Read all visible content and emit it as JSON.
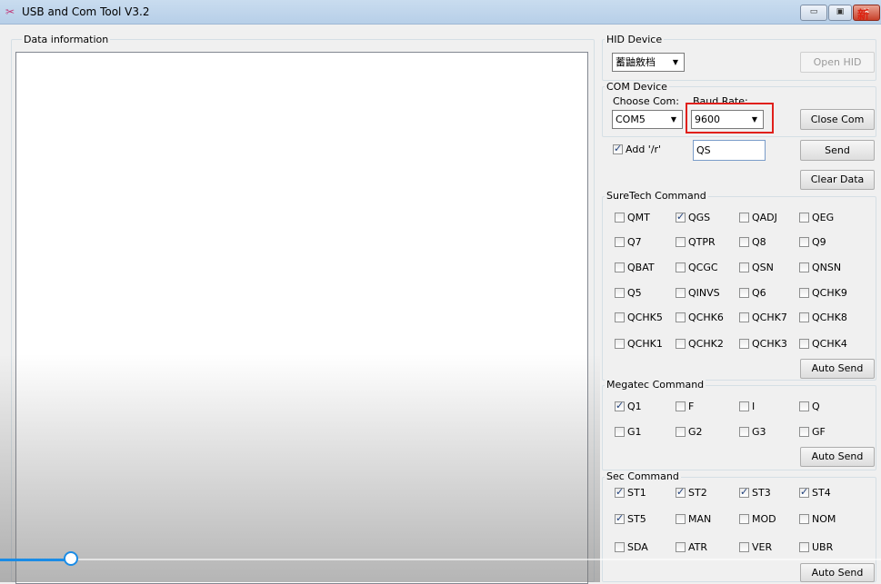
{
  "window": {
    "title": "USB and Com Tool V3.2",
    "app_icon": "tool-icon",
    "minimize": "▭",
    "maximize": "▣",
    "close": "✕",
    "overlay_text": "新"
  },
  "data_info": {
    "title": "Data information"
  },
  "hid": {
    "title": "HID Device",
    "device_value": "蓄鼬敫档",
    "open_label": "Open HID"
  },
  "com": {
    "title": "COM Device",
    "choose_label": "Choose Com:",
    "baud_label": "Baud Rate:",
    "com_value": "COM5",
    "baud_value": "9600",
    "close_label": "Close Com",
    "add_r_label": "Add '/r'",
    "send_text": "QS",
    "send_label": "Send",
    "clear_label": "Clear Data"
  },
  "suretech": {
    "title": "SureTech Command",
    "items": [
      {
        "label": "QMT",
        "checked": false
      },
      {
        "label": "QGS",
        "checked": true
      },
      {
        "label": "QADJ",
        "checked": false
      },
      {
        "label": "QEG",
        "checked": false
      },
      {
        "label": "Q7",
        "checked": false
      },
      {
        "label": "QTPR",
        "checked": false
      },
      {
        "label": "Q8",
        "checked": false
      },
      {
        "label": "Q9",
        "checked": false
      },
      {
        "label": "QBAT",
        "checked": false
      },
      {
        "label": "QCGC",
        "checked": false
      },
      {
        "label": "QSN",
        "checked": false
      },
      {
        "label": "QNSN",
        "checked": false
      },
      {
        "label": "Q5",
        "checked": false
      },
      {
        "label": "QINVS",
        "checked": false
      },
      {
        "label": "Q6",
        "checked": false
      },
      {
        "label": "QCHK9",
        "checked": false
      },
      {
        "label": "QCHK5",
        "checked": false
      },
      {
        "label": "QCHK6",
        "checked": false
      },
      {
        "label": "QCHK7",
        "checked": false
      },
      {
        "label": "QCHK8",
        "checked": false
      },
      {
        "label": "QCHK1",
        "checked": false
      },
      {
        "label": "QCHK2",
        "checked": false
      },
      {
        "label": "QCHK3",
        "checked": false
      },
      {
        "label": "QCHK4",
        "checked": false
      }
    ],
    "auto_send_label": "Auto Send"
  },
  "megatec": {
    "title": "Megatec Command",
    "items": [
      {
        "label": "Q1",
        "checked": true
      },
      {
        "label": "F",
        "checked": false
      },
      {
        "label": "I",
        "checked": false
      },
      {
        "label": "Q",
        "checked": false
      },
      {
        "label": "G1",
        "checked": false
      },
      {
        "label": "G2",
        "checked": false
      },
      {
        "label": "G3",
        "checked": false
      },
      {
        "label": "GF",
        "checked": false
      }
    ],
    "auto_send_label": "Auto Send"
  },
  "sec": {
    "title": "Sec Command",
    "items": [
      {
        "label": "ST1",
        "checked": true
      },
      {
        "label": "ST2",
        "checked": true
      },
      {
        "label": "ST3",
        "checked": true
      },
      {
        "label": "ST4",
        "checked": true
      },
      {
        "label": "ST5",
        "checked": true
      },
      {
        "label": "MAN",
        "checked": false
      },
      {
        "label": "MOD",
        "checked": false
      },
      {
        "label": "NOM",
        "checked": false
      },
      {
        "label": "SDA",
        "checked": false
      },
      {
        "label": "ATR",
        "checked": false
      },
      {
        "label": "VER",
        "checked": false
      },
      {
        "label": "UBR",
        "checked": false
      }
    ],
    "auto_send_label": "Auto Send"
  },
  "add_r_checked": true,
  "video_progress": 0.08,
  "colors": {
    "accent": "#1a8ce6",
    "highlight": "#e0201b"
  }
}
